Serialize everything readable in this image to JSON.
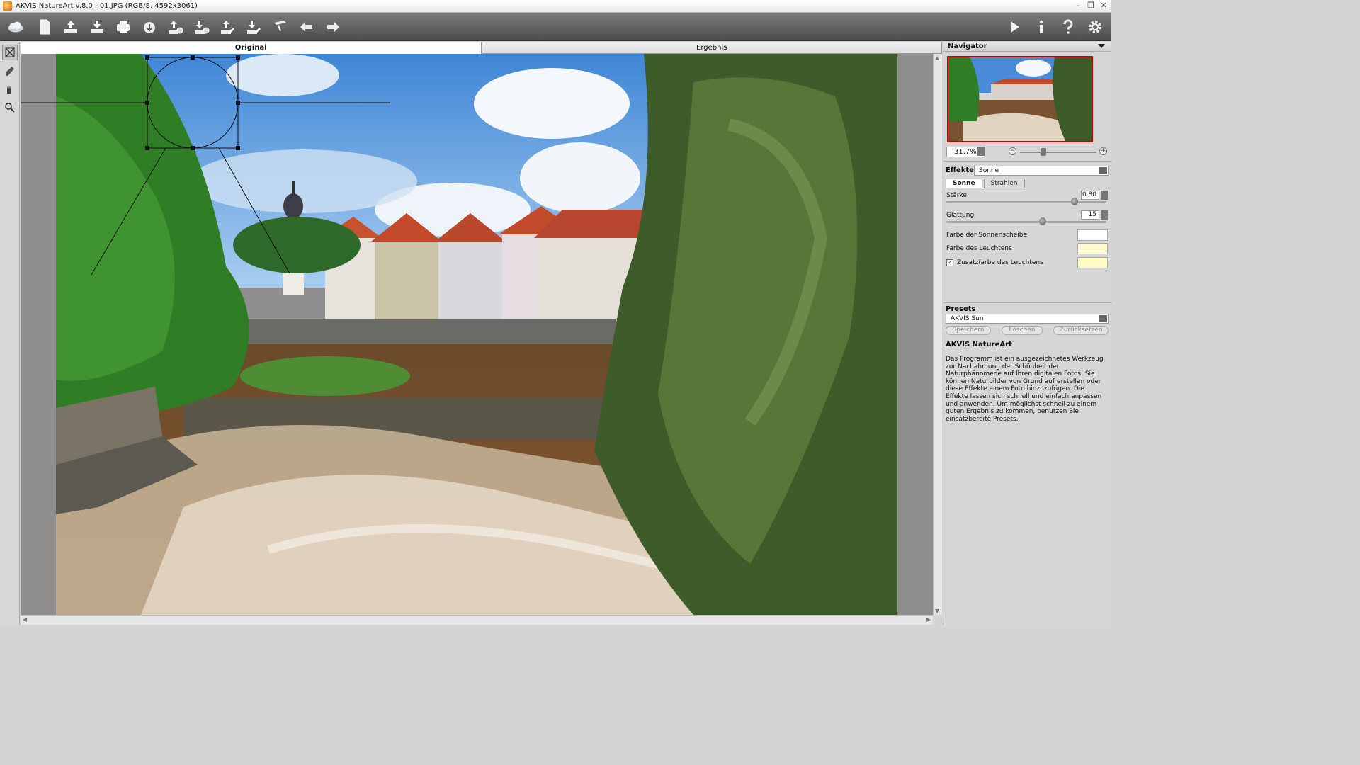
{
  "window": {
    "title": "AKVIS NatureArt v.8.0 - 01.JPG (RGB/8, 4592x3061)",
    "controls": [
      "–",
      "❐",
      "✕"
    ]
  },
  "toolbar": {
    "left_icons": [
      "logo-icon",
      "new-file-icon",
      "open-icon",
      "save-icon",
      "print-icon",
      "batch-icon",
      "load-settings-icon",
      "save-settings-icon",
      "export-icon",
      "import-icon",
      "brush-icon",
      "undo-icon",
      "redo-icon"
    ],
    "right_icons": [
      "run-icon",
      "info-icon",
      "help-icon",
      "settings-icon"
    ]
  },
  "tabs": {
    "original": "Original",
    "result": "Ergebnis"
  },
  "navigator": {
    "title": "Navigator",
    "zoom": "31.7%",
    "zoom_level": 0.31
  },
  "effects": {
    "label": "Effekte:",
    "selected": "Sonne",
    "subtabs": [
      "Sonne",
      "Strahlen"
    ],
    "params": {
      "staerke": {
        "label": "Stärke",
        "value": "0,80",
        "fraction": 0.8
      },
      "glaettung": {
        "label": "Glättung",
        "value": "15",
        "fraction": 0.6
      }
    },
    "colors": {
      "sonnenscheibe": {
        "label": "Farbe der Sonnenscheibe",
        "color": "#ffffff"
      },
      "leuchtens": {
        "label": "Farbe des Leuchtens",
        "color": "#fff9d0"
      },
      "zusatz": {
        "label": "Zusatzfarbe des Leuchtens",
        "color": "#fffbc2",
        "checked": true,
        "check": "✓"
      }
    }
  },
  "presets": {
    "title": "Presets",
    "selected": "AKVIS Sun",
    "buttons": {
      "save": "Speichern",
      "delete": "Löschen",
      "reset": "Zurücksetzen"
    }
  },
  "info": {
    "title": "AKVIS NatureArt",
    "text": "Das Programm ist ein ausgezeichnetes Werkzeug zur Nachahmung der Schönheit der Naturphänomene auf Ihren digitalen Fotos. Sie können Naturbilder von Grund auf erstellen oder diese Effekte einem Foto hinzuzufügen. Die Effekte lassen sich schnell und einfach anpassen und anwenden. Um möglichst schnell zu einem guten Ergebnis zu kommen, benutzen Sie einsatzbereite Presets."
  },
  "colors": {
    "toolbar_bg": "#5a5a5a",
    "accent_red": "#b00000"
  }
}
